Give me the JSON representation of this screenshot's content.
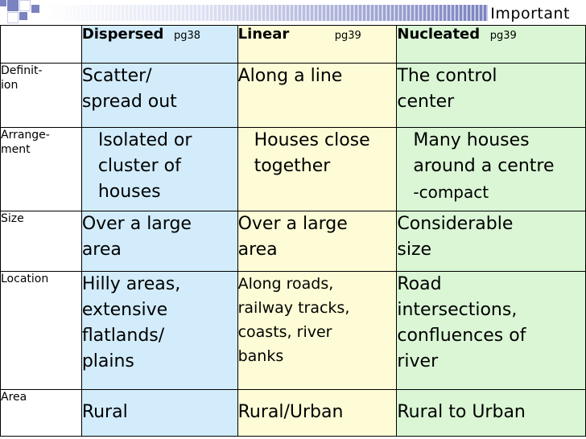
{
  "header": {
    "important_label": "Important"
  },
  "table": {
    "columns": [
      {
        "title": "Dispersed",
        "page_ref": "pg38"
      },
      {
        "title": "Linear",
        "page_ref": "pg39"
      },
      {
        "title": "Nucleated",
        "page_ref": "pg39"
      }
    ],
    "rows": [
      {
        "label": [
          "Definit-",
          "ion"
        ],
        "cells": [
          [
            "Scatter/",
            "spread out"
          ],
          [
            "Along a line"
          ],
          [
            "The control",
            "center"
          ]
        ]
      },
      {
        "label": [
          "Arrange-",
          "ment"
        ],
        "cells": [
          [
            "Isolated or",
            "cluster of",
            "houses"
          ],
          [
            "Houses close",
            "together"
          ],
          [
            "Many houses",
            "around a centre",
            "-compact"
          ]
        ]
      },
      {
        "label": [
          "Size"
        ],
        "cells": [
          [
            "Over a large",
            "area"
          ],
          [
            "Over a large",
            "area"
          ],
          [
            "Considerable",
            "size"
          ]
        ]
      },
      {
        "label": [
          "Location"
        ],
        "cells": [
          [
            "Hilly areas,",
            "extensive",
            "flatlands/",
            "plains"
          ],
          [
            "Along roads,",
            "railway tracks,",
            "coasts, river",
            "banks"
          ],
          [
            "Road",
            "intersections,",
            "confluences of",
            "river"
          ]
        ]
      },
      {
        "label": [
          "Area"
        ],
        "cells": [
          [
            "Rural"
          ],
          [
            "Rural/Urban"
          ],
          [
            "Rural to Urban"
          ]
        ]
      }
    ]
  },
  "colors": {
    "dispersed_bg": "#d2ecfb",
    "linear_bg": "#fdfcd6",
    "nucleated_bg": "#daf6d5",
    "strip_accent": "#7a82c0"
  }
}
